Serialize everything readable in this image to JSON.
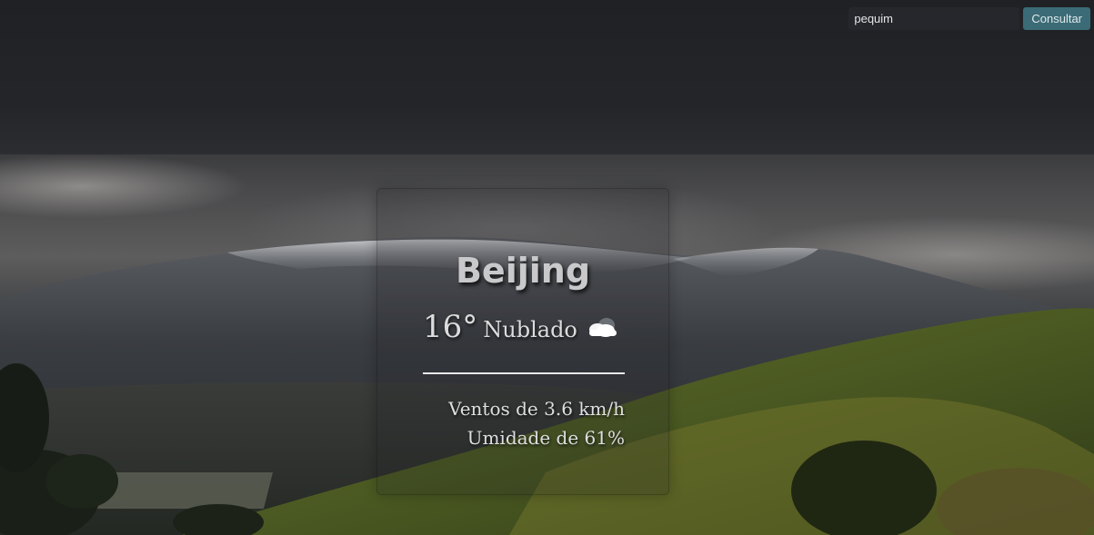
{
  "search": {
    "value": "pequim",
    "button_label": "Consultar"
  },
  "weather": {
    "city": "Beijing",
    "temperature": "16°",
    "condition": "Nublado",
    "icon": "cloud-icon",
    "wind": "Ventos de 3.6 km/h",
    "humidity": "Umidade de 61%"
  },
  "colors": {
    "button_bg": "#3b6b76",
    "input_bg": "#26282c",
    "text_light": "#dcdcdd"
  }
}
